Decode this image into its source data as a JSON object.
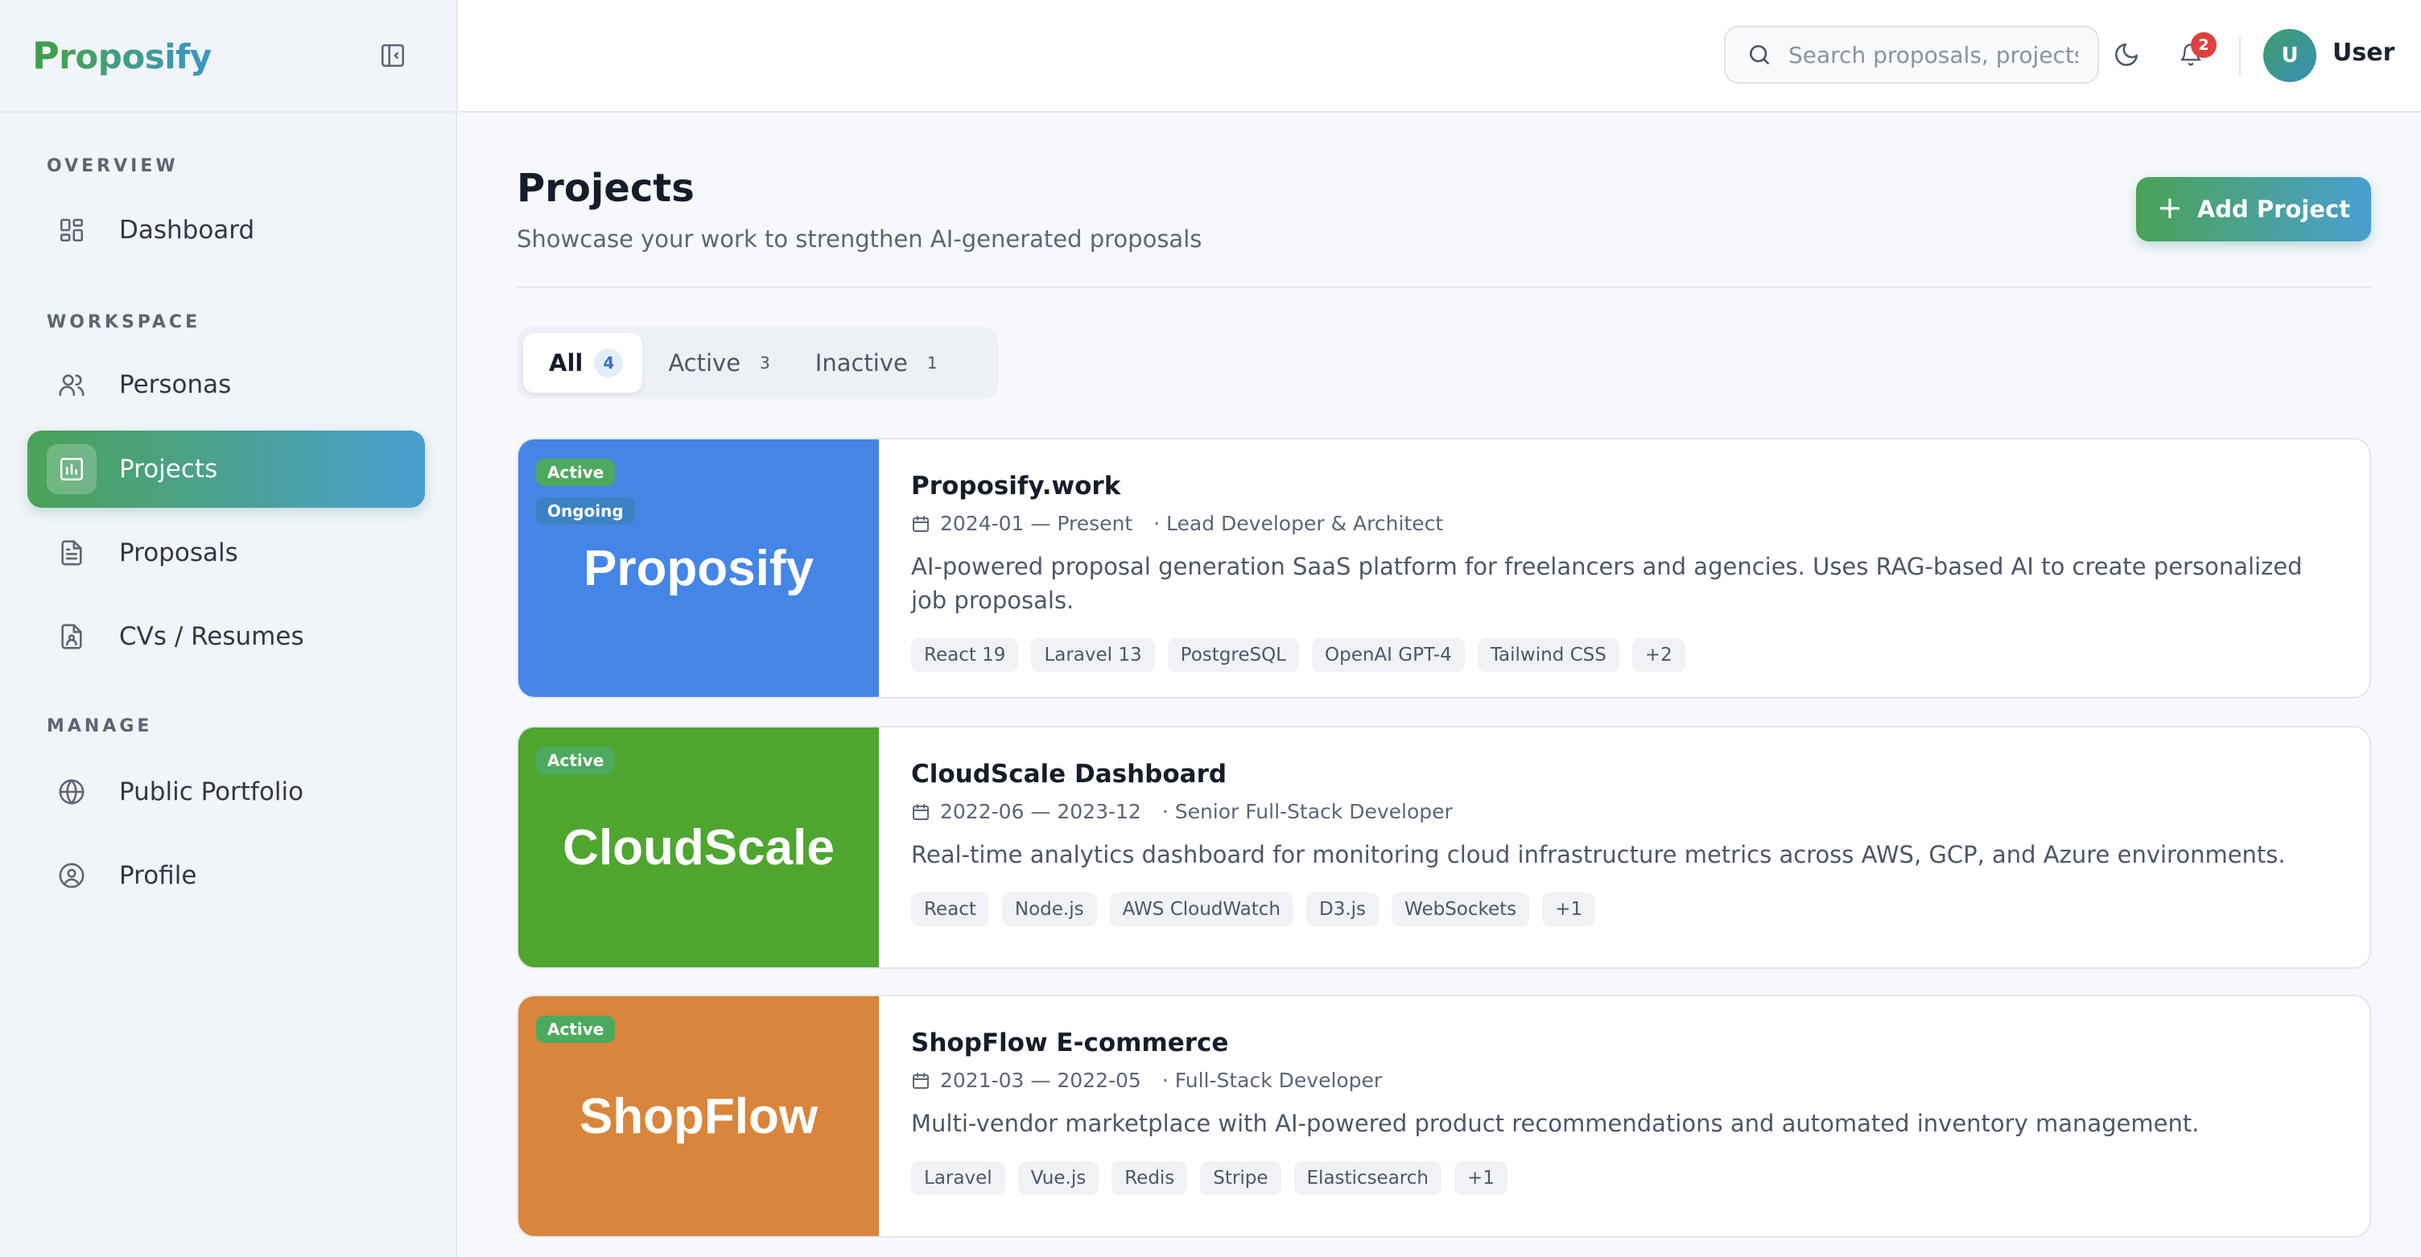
{
  "app": {
    "logo_initial": "P",
    "logo_rest": "roposify"
  },
  "sidebar": {
    "sections": [
      {
        "title": "OVERVIEW",
        "items": [
          {
            "label": "Dashboard",
            "icon": "grid-icon"
          }
        ]
      },
      {
        "title": "WORKSPACE",
        "items": [
          {
            "label": "Personas",
            "icon": "users-icon"
          },
          {
            "label": "Projects",
            "icon": "chart-icon",
            "active": true
          },
          {
            "label": "Proposals",
            "icon": "file-text-icon"
          },
          {
            "label": "CVs / Resumes",
            "icon": "file-user-icon"
          }
        ]
      },
      {
        "title": "MANAGE",
        "items": [
          {
            "label": "Public Portfolio",
            "icon": "globe-icon"
          },
          {
            "label": "Profile",
            "icon": "user-circle-icon"
          }
        ]
      }
    ]
  },
  "header": {
    "search_placeholder": "Search proposals, projects...",
    "notifications_count": "2",
    "user_initial": "U",
    "user_name": "User"
  },
  "main": {
    "title": "Projects",
    "subtitle": "Showcase your work to strengthen AI-generated proposals",
    "add_button": "Add Project",
    "tabs": [
      {
        "label": "All",
        "count": "4",
        "active": true
      },
      {
        "label": "Active",
        "count": "3"
      },
      {
        "label": "Inactive",
        "count": "1"
      }
    ],
    "projects": [
      {
        "brand": "Proposify",
        "color": "#4585e6",
        "status": "Active",
        "badge2": "Ongoing",
        "title": "Proposify.work",
        "dates": "2024-01 — Present",
        "role": "· Lead Developer & Architect",
        "description": "AI-powered proposal generation SaaS platform for freelancers and agencies. Uses RAG-based AI to create personalized job proposals.",
        "tags": [
          "React 19",
          "Laravel 13",
          "PostgreSQL",
          "OpenAI GPT-4",
          "Tailwind CSS",
          "+2"
        ]
      },
      {
        "brand": "CloudScale",
        "color": "#4ea62f",
        "status": "Active",
        "title": "CloudScale Dashboard",
        "dates": "2022-06 — 2023-12",
        "role": "· Senior Full-Stack Developer",
        "description": "Real-time analytics dashboard for monitoring cloud infrastructure metrics across AWS, GCP, and Azure environments.",
        "tags": [
          "React",
          "Node.js",
          "AWS CloudWatch",
          "D3.js",
          "WebSockets",
          "+1"
        ]
      },
      {
        "brand": "ShopFlow",
        "color": "#d9853b",
        "status": "Active",
        "title": "ShopFlow E-commerce",
        "dates": "2021-03 — 2022-05",
        "role": "· Full-Stack Developer",
        "description": "Multi-vendor marketplace with AI-powered product recommendations and automated inventory management.",
        "tags": [
          "Laravel",
          "Vue.js",
          "Redis",
          "Stripe",
          "Elasticsearch",
          "+1"
        ]
      }
    ]
  }
}
